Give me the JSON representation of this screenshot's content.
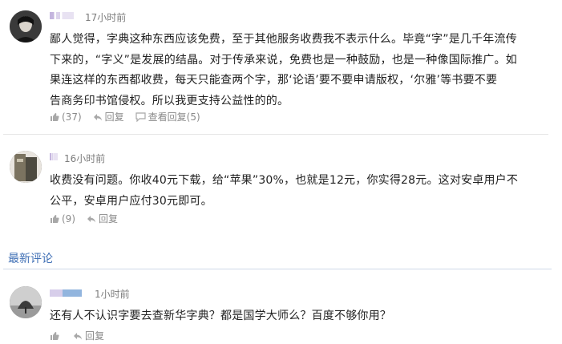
{
  "comments": [
    {
      "time": "17小时前",
      "lines": [
        "鄙人觉得，字典这种东西应该免费，至于其他服务收费我不表示什么。毕竟“字”是几千年流传",
        "下来的，“字义”是发展的结晶。对于传承来说，免费也是一种鼓励，也是一种像国际推广。如",
        "果连这样的东西都收费，每天只能查两个字，那‘论语’要不要申请版权，‘尔雅’等书要不要",
        "告商务印书馆侵权。所以我更支持公益性的的。"
      ],
      "like_count": "(37)",
      "reply_label": "回复",
      "view_replies_label": "查看回复(5)"
    },
    {
      "time": "16小时前",
      "lines": [
        "收费没有问题。你收40元下载，给“苹果”30%，也就是12元，你实得28元。这对安卓用户不",
        "公平，安卓用户应付30元即可。"
      ],
      "like_count": "(9)",
      "reply_label": "回复"
    }
  ],
  "latest_section": {
    "title": "最新评论",
    "comments": [
      {
        "time": "1小时前",
        "text": "还有人不认识字要去查新华字典？都是国学大师么？百度不够你用？",
        "like_label": "",
        "reply_label": "回复"
      }
    ]
  },
  "icons": {
    "like": "thumbs-up-icon",
    "reply": "reply-arrow-icon",
    "view_replies": "speech-bubble-icon"
  },
  "colors": {
    "section_title": "#3f6fb5",
    "meta_text": "#8a8a8a"
  }
}
